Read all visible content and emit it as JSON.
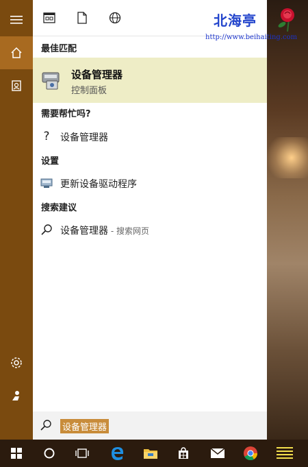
{
  "watermark": {
    "logo_text": "北海亭",
    "url": "http://www.beihaiting.com"
  },
  "sections": {
    "best_match": "最佳匹配",
    "help": "需要帮忙吗?",
    "settings": "设置",
    "suggestions": "搜索建议"
  },
  "best_match_item": {
    "title": "设备管理器",
    "subtitle": "控制面板"
  },
  "help_item": {
    "label": "设备管理器"
  },
  "settings_item": {
    "label": "更新设备驱动程序"
  },
  "suggestion_item": {
    "label": "设备管理器",
    "hint": " - 搜索网页"
  },
  "search": {
    "query": "设备管理器"
  },
  "colors": {
    "rail": "#7a4a0f",
    "rail_active": "#a86a20",
    "best_match_bg": "#eeedc6",
    "taskbar": "#2b1b0e",
    "search_highlight": "#c88c3a"
  },
  "icons": {
    "rail": [
      "hamburger-icon",
      "home-icon",
      "documents-icon",
      "settings-gear-icon",
      "user-icon"
    ],
    "toolbar": [
      "apps-icon",
      "document-icon",
      "globe-icon"
    ],
    "taskbar": [
      "windows-start-icon",
      "cortana-icon",
      "task-view-icon",
      "edge-icon",
      "file-explorer-icon",
      "store-icon",
      "mail-icon",
      "chrome-icon",
      "notes-icon"
    ]
  }
}
